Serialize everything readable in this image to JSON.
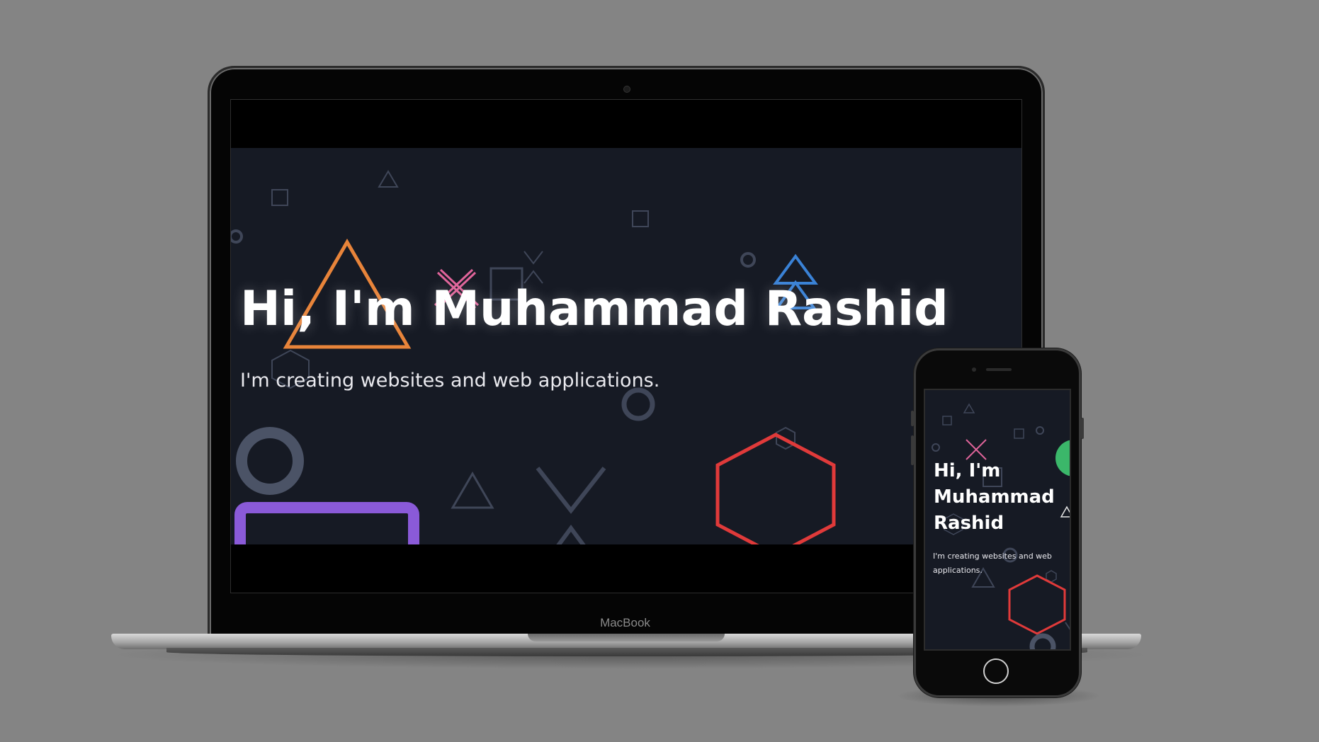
{
  "laptop": {
    "brand": "MacBook"
  },
  "site": {
    "hero_title": "Hi, I'm Muhammad Rashid",
    "hero_subtitle": "I'm creating websites and web applications."
  },
  "phone": {
    "hero_title": "Hi, I'm Muhammad Rashid",
    "hero_subtitle": "I'm creating websites and web applications."
  },
  "colors": {
    "page_background": "#848484",
    "site_background": "#161a24",
    "accent_orange": "#e8843a",
    "accent_pink": "#e0649a",
    "accent_blue": "#3a82d6",
    "accent_green": "#3bb76a",
    "accent_red": "#e03a3a",
    "accent_purple": "#8a5ad8",
    "muted_shape": "#3f4658"
  }
}
